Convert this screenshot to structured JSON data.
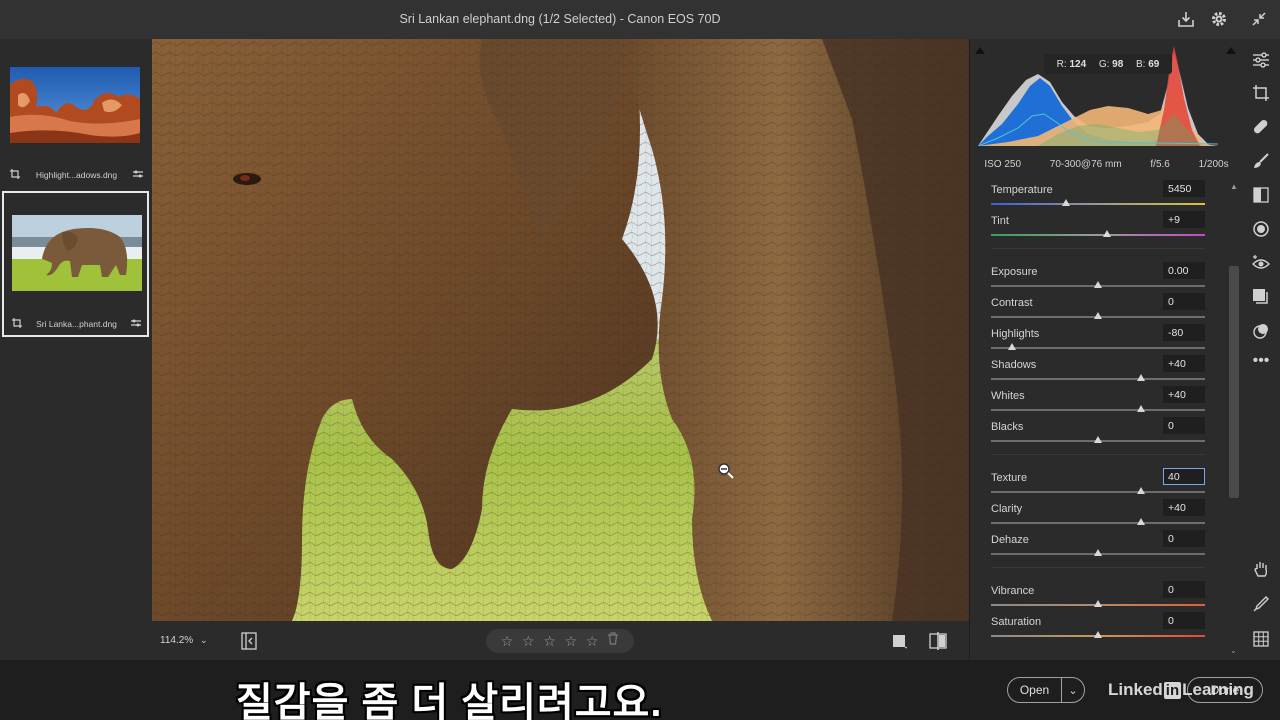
{
  "window": {
    "title": "Sri Lankan elephant.dng (1/2 Selected)  -  Canon EOS 70D"
  },
  "filmstrip": {
    "items": [
      {
        "name": "Highlight...adows.dng",
        "selected": false
      },
      {
        "name": "Sri Lanka...phant.dng",
        "selected": true
      }
    ]
  },
  "bottom_toolbar": {
    "zoom": "114.2%",
    "rating_max": 5
  },
  "histogram": {
    "r_label": "R:",
    "r_value": "124",
    "g_label": "G:",
    "g_value": "98",
    "b_label": "B:",
    "b_value": "69"
  },
  "metadata": {
    "iso": "ISO 250",
    "lens": "70-300@76 mm",
    "aperture": "f/5.6",
    "shutter": "1/200s"
  },
  "sliders": [
    {
      "label": "Temperature",
      "value": "5450",
      "level": 0.35,
      "track": "temp"
    },
    {
      "label": "Tint",
      "value": "+9",
      "level": 0.54,
      "track": "tint"
    },
    {
      "label": "Exposure",
      "value": "0.00",
      "level": 0.5,
      "track": "plain"
    },
    {
      "label": "Contrast",
      "value": "0",
      "level": 0.5,
      "track": "plain"
    },
    {
      "label": "Highlights",
      "value": "-80",
      "level": 0.1,
      "track": "plain"
    },
    {
      "label": "Shadows",
      "value": "+40",
      "level": 0.7,
      "track": "plain"
    },
    {
      "label": "Whites",
      "value": "+40",
      "level": 0.7,
      "track": "plain"
    },
    {
      "label": "Blacks",
      "value": "0",
      "level": 0.5,
      "track": "plain"
    },
    {
      "label": "Texture",
      "value": "40",
      "level": 0.7,
      "track": "plain",
      "active": true
    },
    {
      "label": "Clarity",
      "value": "+40",
      "level": 0.7,
      "track": "plain"
    },
    {
      "label": "Dehaze",
      "value": "0",
      "level": 0.5,
      "track": "plain"
    },
    {
      "label": "Vibrance",
      "value": "0",
      "level": 0.5,
      "track": "vibrance"
    },
    {
      "label": "Saturation",
      "value": "0",
      "level": 0.5,
      "track": "saturation"
    }
  ],
  "footer": {
    "subtitle": "질감을 좀 더 살리려고요.",
    "open_label": "Open",
    "done_label": "Done",
    "brand_left": "Linked",
    "brand_in": "in",
    "brand_right": "Learning"
  },
  "colors": {
    "accent": "#7aa6e8",
    "panel": "#2b2b2b",
    "canvas_bg": "#1e1e1e"
  }
}
